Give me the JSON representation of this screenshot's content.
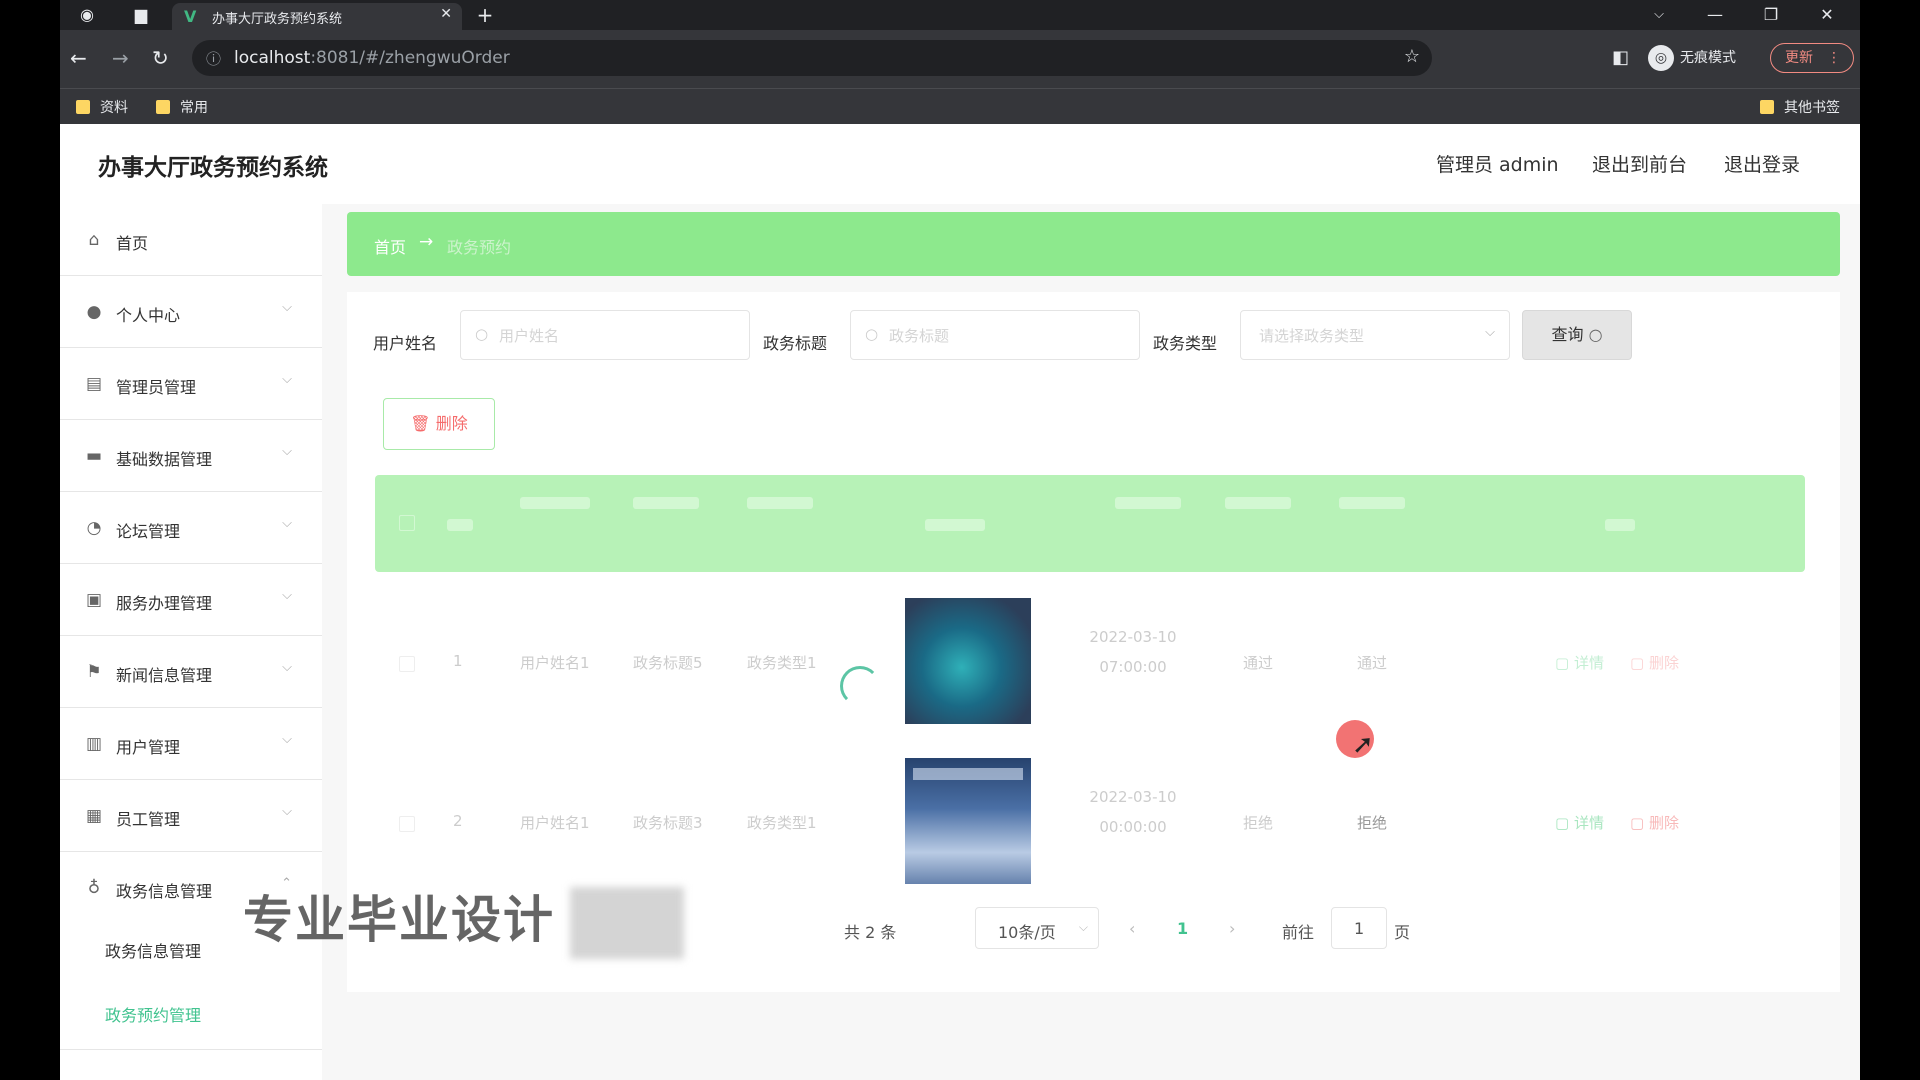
{
  "browser": {
    "tab_title": "办事大厅政务预约系统",
    "url_host": "localhost",
    "url_rest": ":8081/#/zhengwuOrder",
    "incognito_label": "无痕模式",
    "update_label": "更新",
    "bookmarks": [
      "资料",
      "常用"
    ],
    "other_bookmarks": "其他书签"
  },
  "app": {
    "brand": "办事大厅政务预约系统",
    "header_links": [
      "管理员 admin",
      "退出到前台",
      "退出登录"
    ]
  },
  "sidebar": {
    "items": [
      {
        "label": "首页",
        "icon": "home-icon"
      },
      {
        "label": "个人中心",
        "icon": "user-icon"
      },
      {
        "label": "管理员管理",
        "icon": "clipboard-icon"
      },
      {
        "label": "基础数据管理",
        "icon": "monitor-icon"
      },
      {
        "label": "论坛管理",
        "icon": "bell-icon"
      },
      {
        "label": "服务办理管理",
        "icon": "clipboard-check-icon"
      },
      {
        "label": "新闻信息管理",
        "icon": "flag-icon"
      },
      {
        "label": "用户管理",
        "icon": "document-icon"
      },
      {
        "label": "员工管理",
        "icon": "grid-icon"
      },
      {
        "label": "政务信息管理",
        "icon": "microphone-icon"
      }
    ],
    "sub_items": [
      "政务信息管理",
      "政务预约管理"
    ]
  },
  "breadcrumb": {
    "home": "首页",
    "arrow": "→",
    "current": "政务预约"
  },
  "filters": {
    "username_label": "用户姓名",
    "username_placeholder": "用户姓名",
    "title_label": "政务标题",
    "title_placeholder": "政务标题",
    "type_label": "政务类型",
    "type_placeholder": "请选择政务类型",
    "query_label": "查询"
  },
  "actions": {
    "delete_label": "删除"
  },
  "rows": [
    {
      "index": "1",
      "name": "用户姓名1",
      "title": "政务标题5",
      "type": "政务类型1",
      "time": "2022-03-10 07:00:00",
      "status1": "通过",
      "status2": "通过",
      "detail": "详情",
      "delete": "删除"
    },
    {
      "index": "2",
      "name": "用户姓名1",
      "title": "政务标题3",
      "type": "政务类型1",
      "time": "2022-03-10 00:00:00",
      "status1": "拒绝",
      "status2": "拒绝",
      "detail": "详情",
      "delete": "删除"
    }
  ],
  "pagination": {
    "total": "共 2 条",
    "page_size": "10条/页",
    "current": "1",
    "goto": "前往",
    "goto_value": "1",
    "page_suffix": "页"
  },
  "overlay": {
    "watermark": "专业毕业设计"
  },
  "colors": {
    "breadcrumb": "#8de98d",
    "table_header": "#b7f2b7",
    "accent": "#41c38f",
    "danger": "#f56c6c"
  }
}
